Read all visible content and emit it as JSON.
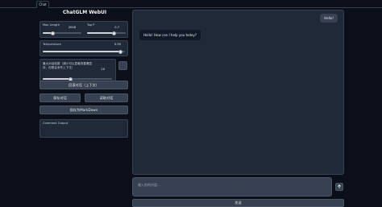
{
  "tabs": [
    {
      "label": "Chat"
    }
  ],
  "app_title": "ChatGLM WebUI",
  "params": {
    "max_length": {
      "label": "Max Length",
      "value": "2048",
      "fraction": 0.25
    },
    "top_p": {
      "label": "Top P",
      "value": "0.7",
      "fraction": 0.7
    },
    "temperature": {
      "label": "Temperature",
      "value": "0.95",
      "fraction": 0.95
    },
    "rounds": {
      "label": "最大对话轮数（调小可以显著改善爆显存，但是会丢失上下文）",
      "value": "20",
      "fraction": 0.4
    }
  },
  "buttons": {
    "revert": "回滚对话（上下文）",
    "save": "保存对话",
    "load": "读取对话",
    "save_markdown": "保存为MarkDown",
    "send": "发送"
  },
  "comment_label": "Comment Output",
  "chat": {
    "messages": [
      {
        "role": "user",
        "text": "Hello!"
      },
      {
        "role": "bot",
        "text": "Hello! How can I help you today?"
      }
    ]
  },
  "input": {
    "placeholder": "输入你的内容..."
  }
}
